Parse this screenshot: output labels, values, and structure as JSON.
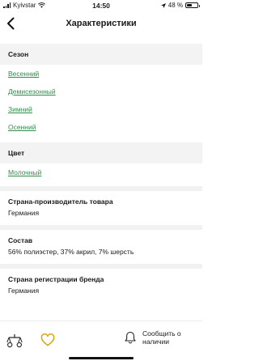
{
  "status_bar": {
    "carrier": "Kyivstar",
    "time": "14:50",
    "battery_text": "48 %",
    "battery_level": 0.48
  },
  "nav": {
    "title": "Характеристики"
  },
  "season": {
    "title": "Сезон",
    "items": [
      "Весенний",
      "Демисезонный",
      "Зимний",
      "Осенний"
    ]
  },
  "color": {
    "title": "Цвет",
    "items": [
      "Молочный"
    ]
  },
  "sections": [
    {
      "title": "Страна-производитель товара",
      "value": "Германия"
    },
    {
      "title": "Состав",
      "value": "56% полиэстер, 37% акрил, 7% шерсть"
    },
    {
      "title": "Страна регистрации бренда",
      "value": "Германия"
    }
  ],
  "bottom_bar": {
    "notify_label": "Сообщить о наличии",
    "accent": "#2f8f4a",
    "heart_color": "#d4a514"
  }
}
